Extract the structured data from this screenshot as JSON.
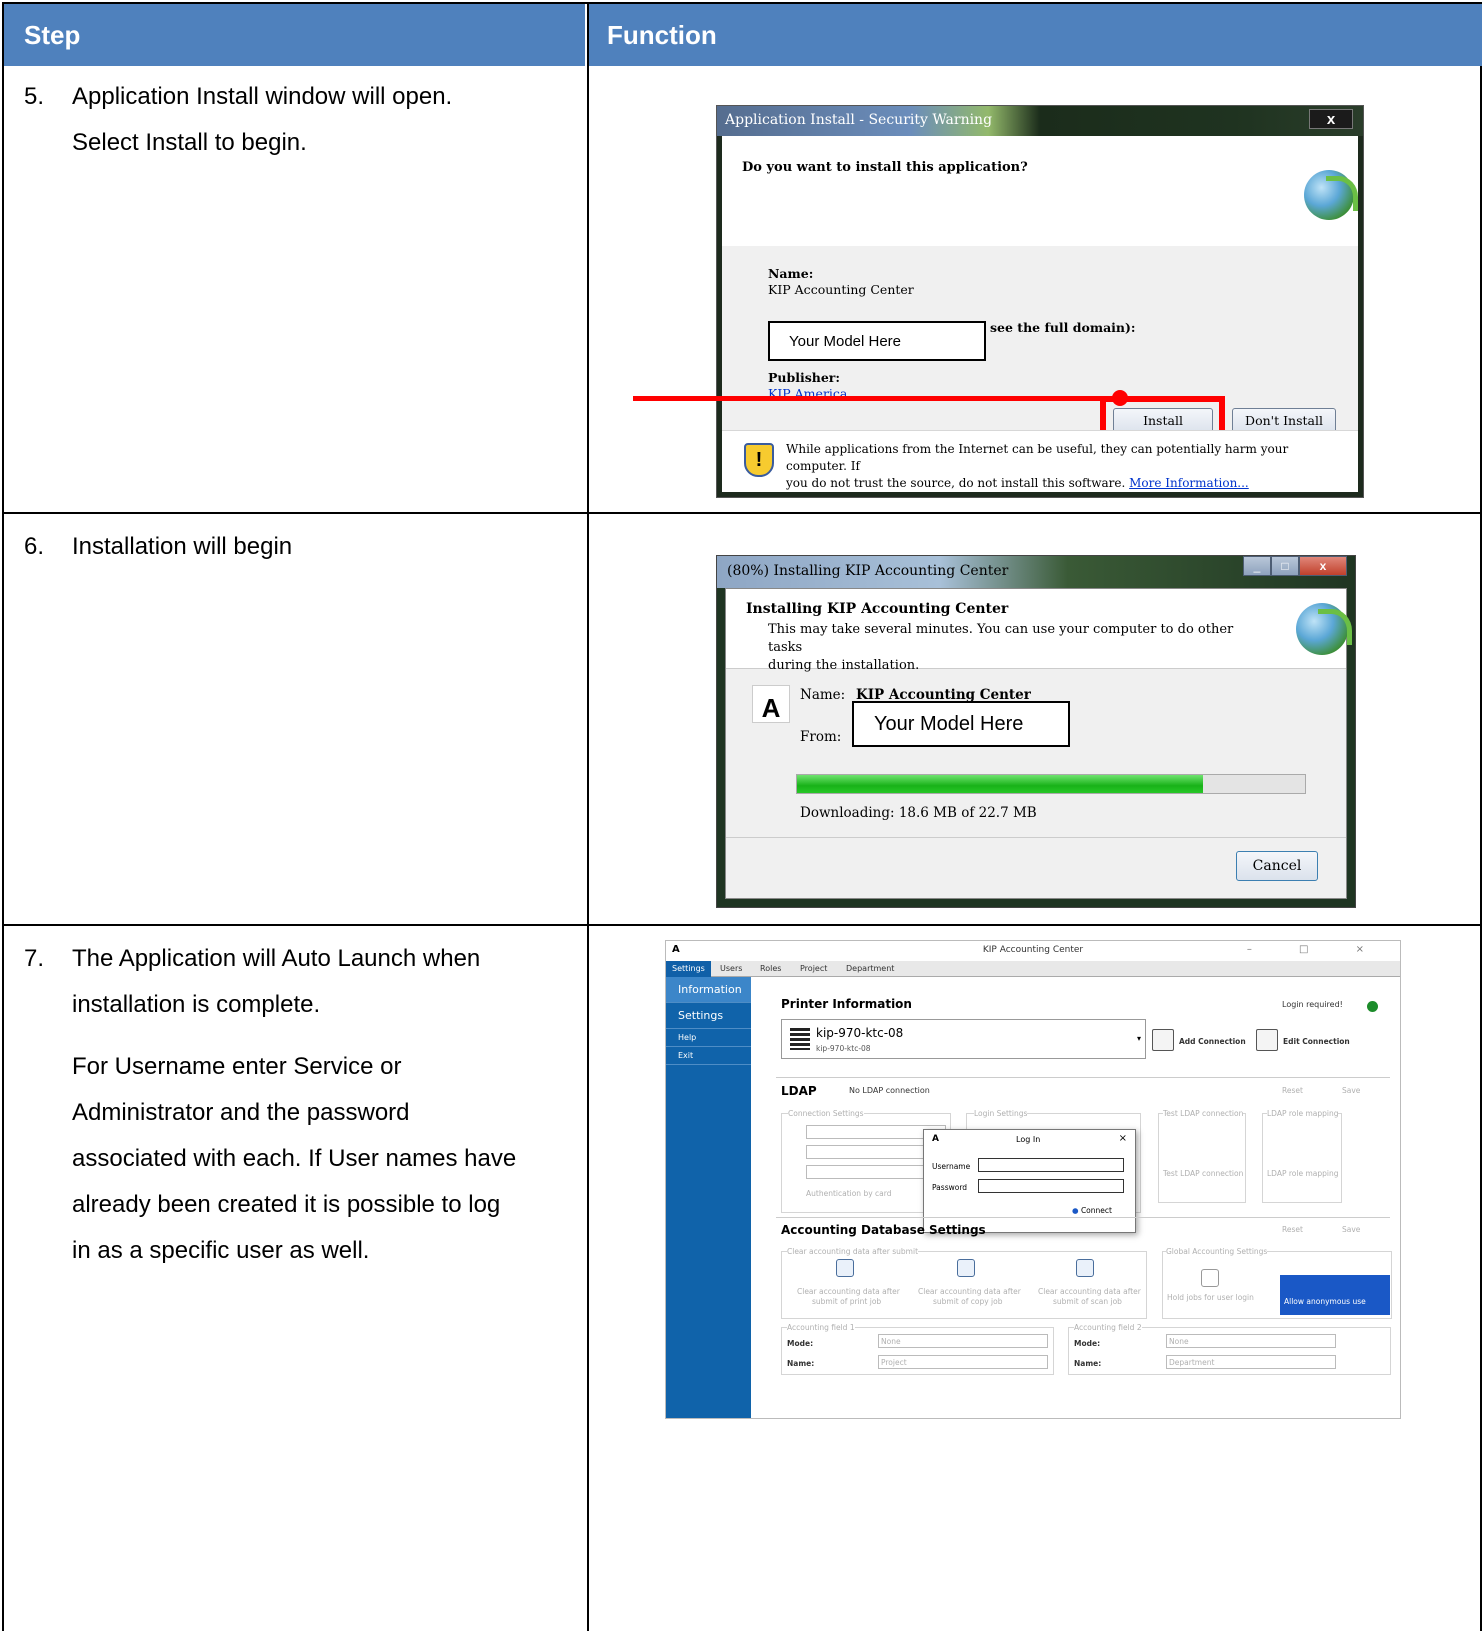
{
  "table": {
    "header": {
      "step": "Step",
      "function": "Function"
    },
    "rows": [
      {
        "num": "5.",
        "lines": [
          "Application Install window will open.",
          "Select Install to begin."
        ]
      },
      {
        "num": "6.",
        "lines": [
          "Installation will begin"
        ]
      },
      {
        "num": "7.",
        "lines": [
          "The Application will Auto Launch when",
          "installation is complete."
        ],
        "para": [
          "For Username enter Service or",
          "Administrator and the password",
          "associated with each. If User names have",
          "already been created it is possible to log",
          "in as a specific user as well."
        ]
      }
    ]
  },
  "security_dialog": {
    "title": "Application Install - Security Warning",
    "close": "x",
    "question": "Do you want to install this application?",
    "name_label": "Name:",
    "name_value": "KIP Accounting Center",
    "from_suffix": "see the full domain):",
    "model_placeholder": "Your Model Here",
    "publisher_label": "Publisher:",
    "publisher_value": "KIP America",
    "install_button": "Install",
    "dont_install_button": "Don't Install",
    "warning_line1": "While applications from the Internet can be useful, they can potentially harm your computer. If",
    "warning_line2": "you do not trust the source, do not install this software.",
    "more_info": "More Information...",
    "highlight_color": "#ff0000"
  },
  "install_dialog": {
    "title": "(80%) Installing KIP Accounting Center",
    "heading": "Installing KIP Accounting Center",
    "sub1": "This may take several minutes. You can use your computer to do other tasks",
    "sub2": "during the installation.",
    "name_label": "Name:",
    "name_value": "KIP Accounting Center",
    "from_label": "From:",
    "model_placeholder": "Your Model Here",
    "progress_fraction": 0.8,
    "status": "Downloading: 18.6 MB of 22.7 MB",
    "cancel_button": "Cancel",
    "app_logo": "A"
  },
  "kip_app": {
    "title": "KIP Accounting Center",
    "title_icon": "A",
    "window_controls": "– □ ×",
    "tabs": [
      "Settings",
      "Users",
      "Roles",
      "Project",
      "Department"
    ],
    "sidebar": [
      "Information",
      "Settings",
      "Help",
      "Exit"
    ],
    "printer_info_title": "Printer Information",
    "login_required": "Login required!",
    "printer_name": "kip-970-ktc-08",
    "printer_sub": "kip-970-ktc-08",
    "add_connection": "Add Connection",
    "edit_connection": "Edit Connection",
    "ldap_title": "LDAP",
    "no_ldap": "No LDAP connection",
    "reset": "Reset",
    "save": "Save",
    "connection_settings": "Connection Settings",
    "login_settings": "Login Settings",
    "test_ldap": "Test LDAP connection",
    "ldap_role": "LDAP role mapping",
    "auth_by_card": "Authentication by card",
    "login_dialog": {
      "icon": "A",
      "title": "Log In",
      "close": "×",
      "username": "Username",
      "password": "Password",
      "connect": "Connect"
    },
    "acct_title": "Accounting Database Settings",
    "clear_after_submit": "Clear accounting data after submit",
    "global_settings": "Global Accounting Settings",
    "clear_print_1": "Clear accounting data after",
    "clear_print_2": "submit of print job",
    "clear_copy_1": "Clear accounting data after",
    "clear_copy_2": "submit of copy job",
    "clear_scan_1": "Clear accounting data after",
    "clear_scan_2": "submit of scan job",
    "hold_jobs": "Hold jobs for user login",
    "allow_anon": "Allow anonymous use",
    "field1": "Accounting field 1",
    "field2": "Accounting field 2",
    "mode_label": "Mode:",
    "name_label": "Name:",
    "mode_value": "None",
    "field1_name": "Project",
    "field2_name": "Department"
  }
}
